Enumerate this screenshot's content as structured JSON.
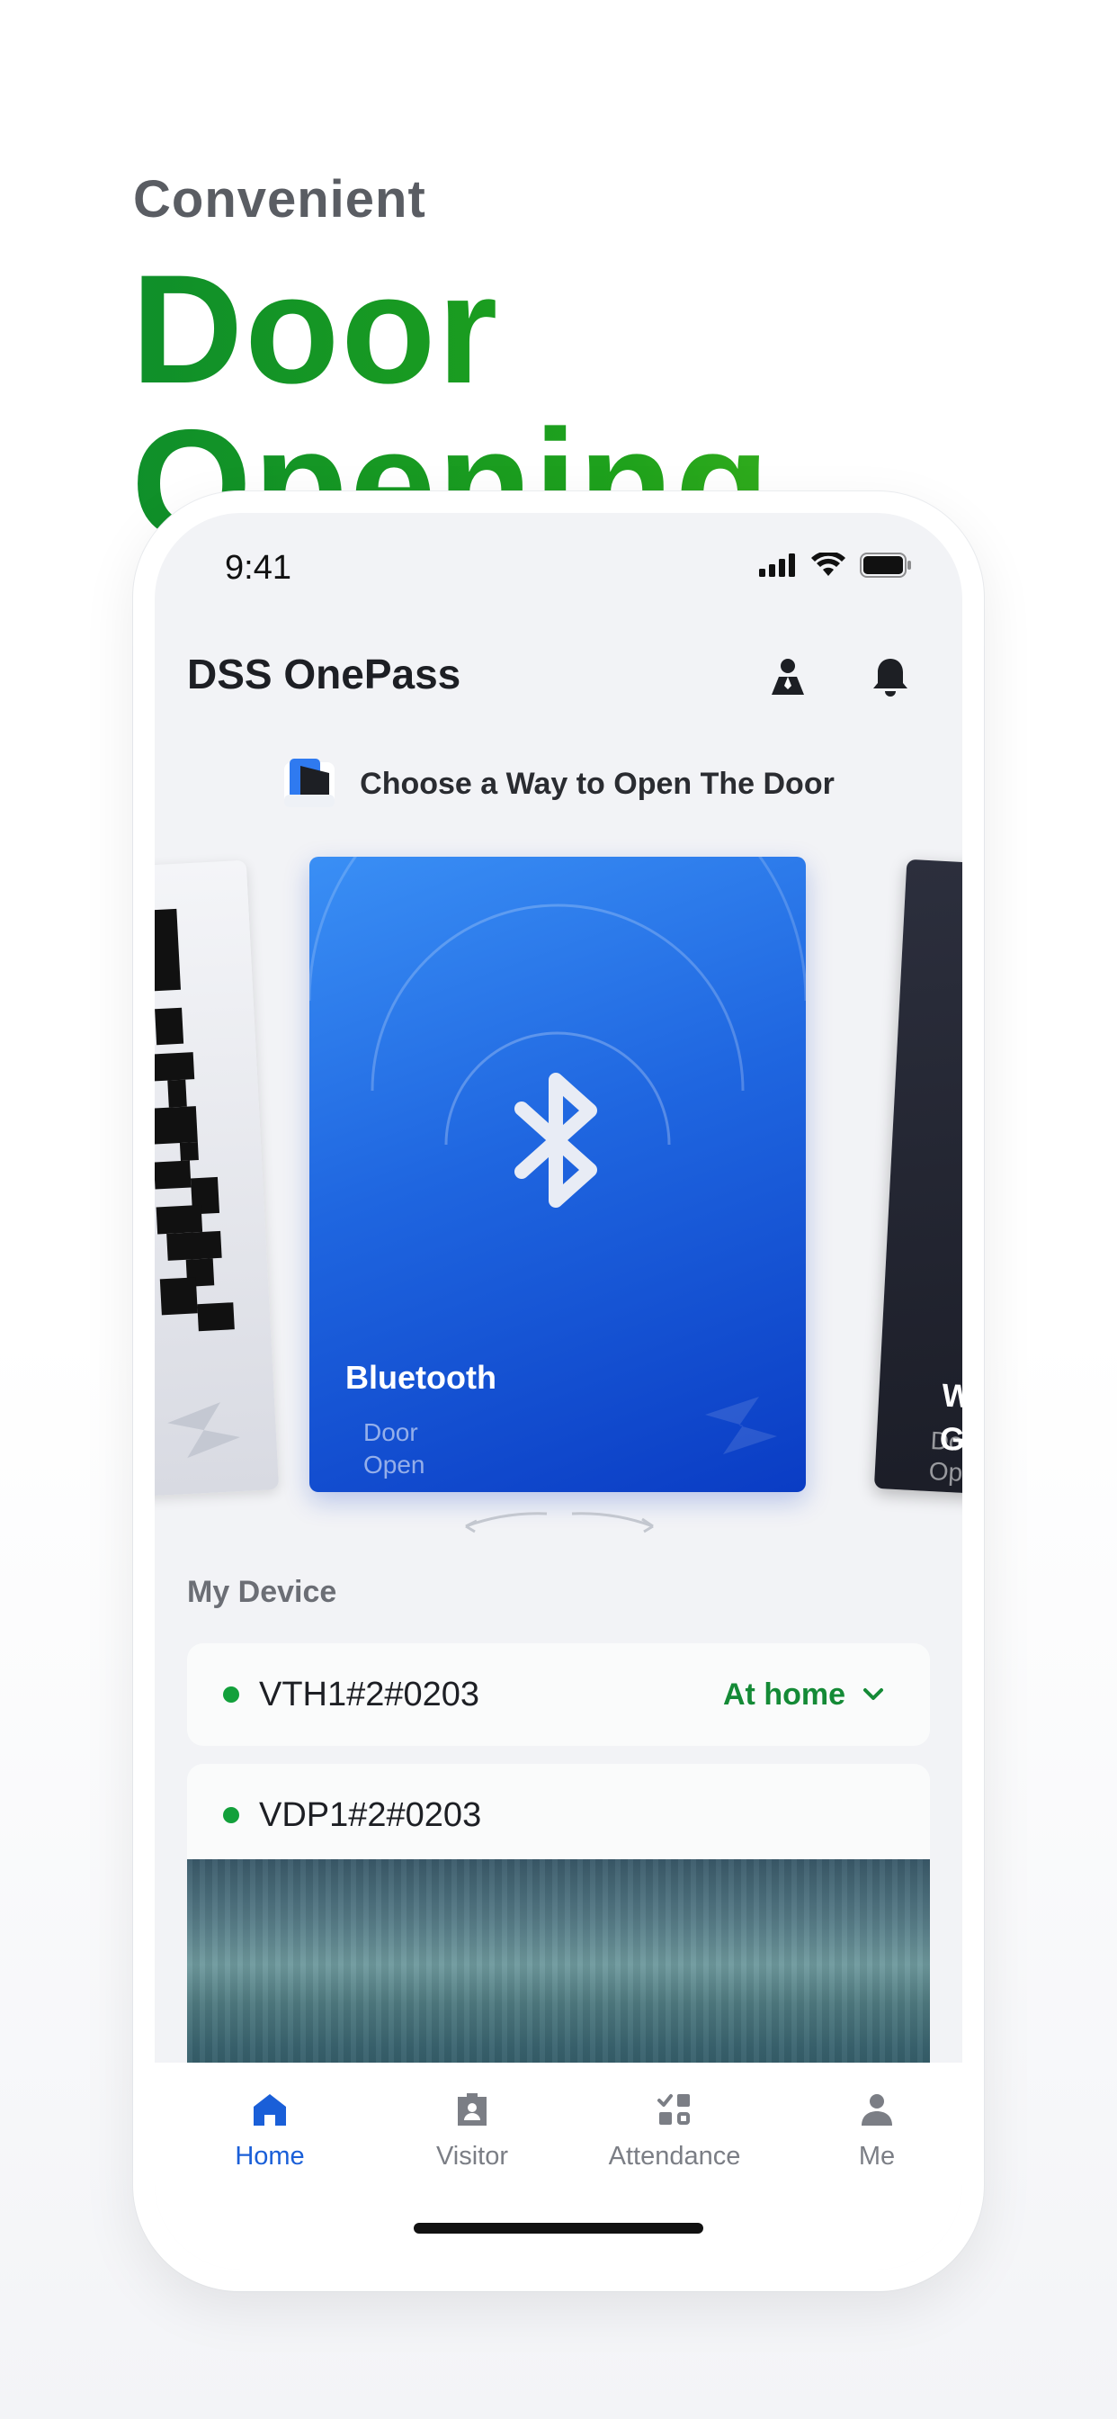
{
  "hero": {
    "subtitle": "Convenient",
    "title": "Door Opening"
  },
  "status_bar": {
    "time": "9:41"
  },
  "app": {
    "title": "DSS OnePass"
  },
  "door": {
    "choose_label": "Choose a Way to Open The Door",
    "cards": {
      "center_title": "Bluetooth",
      "center_sub_line1": "Door",
      "center_sub_line2": "Open",
      "right_title_line1": "We",
      "right_title_line2": "Ga",
      "right_sub_line1": "Do",
      "right_sub_line2": "Ope"
    }
  },
  "devices": {
    "section_label": "My Device",
    "items": [
      {
        "name": "VTH1#2#0203",
        "status": "At home"
      },
      {
        "name": "VDP1#2#0203"
      }
    ]
  },
  "tabbar": {
    "items": [
      {
        "label": "Home",
        "icon": "home-icon"
      },
      {
        "label": "Visitor",
        "icon": "visitor-icon"
      },
      {
        "label": "Attendance",
        "icon": "attendance-icon"
      },
      {
        "label": "Me",
        "icon": "person-icon"
      }
    ]
  },
  "colors": {
    "accent_green": "#1fa21c",
    "active_blue": "#1a5fd8",
    "status_green": "#148a36",
    "bluetooth_card": "#1f66e0"
  }
}
